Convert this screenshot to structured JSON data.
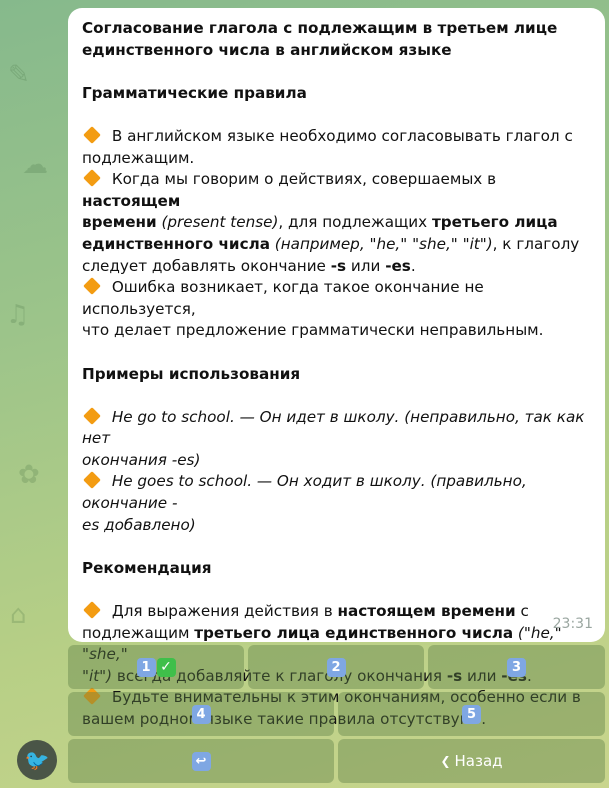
{
  "message": {
    "title_line1": "Согласование глагола с подлежащим в третьем лице",
    "title_line2": "единственного числа в английском языке",
    "section1": "Грамматические правила",
    "rule1_l1": "В английском языке необходимо согласовывать глагол с",
    "rule1_l2": "подлежащим.",
    "rule2_a": "Когда мы говорим о действиях, совершаемых в ",
    "rule2_b": "настоящем",
    "rule2_c": "времени",
    "rule2_d": " (present tense)",
    "rule2_e": ", для подлежащих ",
    "rule2_f": "третьего лица",
    "rule2_g": "единственного числа",
    "rule2_h": " (например, \"he,\" \"she,\" \"it\")",
    "rule2_i": ", к глаголу",
    "rule2_j": "следует добавлять окончание ",
    "rule2_k": "-s",
    "rule2_l": " или ",
    "rule2_m": "-es",
    "rule2_n": ".",
    "rule3_l1": "Ошибка возникает, когда такое окончание не используется,",
    "rule3_l2": "что делает предложение грамматически неправильным.",
    "section2": "Примеры использования",
    "ex1_l1": "He go to school. — Он идет в школу. (неправильно, так как нет",
    "ex1_l2": "окончания -es)",
    "ex2_l1": "He goes to school. — Он ходит в школу. (правильно, окончание -",
    "ex2_l2": "es добавлено)",
    "section3": "Рекомендация",
    "rec1_a": "Для выражения действия в ",
    "rec1_b": "настоящем времени",
    "rec1_c": " с",
    "rec1_d": "подлежащим ",
    "rec1_e": "третьего лица единственного числа",
    "rec1_f": " (\"he,\" \"she,\"",
    "rec1_g": "\"it\")",
    "rec1_h": " всегда добавляйте к глаголу окончания ",
    "rec1_i": "-s",
    "rec1_j": " или ",
    "rec1_k": "-es",
    "rec1_l": ".",
    "rec2_l1": "Будьте внимательны к этим окончаниям, особенно если в",
    "rec2_l2": "вашем родном языке такие правила отсутствуют.",
    "time": "23:31"
  },
  "keyboard": {
    "b1": "1",
    "b1_check": "✓",
    "b2": "2",
    "b3": "3",
    "b4": "4",
    "b5": "5",
    "back_icon": "↩",
    "nav_arrow": "❮",
    "nav_label": "Назад"
  },
  "colors": {
    "accent_diamond": "#f39c12",
    "keycap": "#7fa7e3",
    "check": "#3fbf4a"
  },
  "icons": [
    "orange-diamond-icon",
    "keycap-digit-icon",
    "check-mark-icon",
    "return-arrow-icon",
    "chevron-left-icon",
    "bird-avatar-icon"
  ]
}
